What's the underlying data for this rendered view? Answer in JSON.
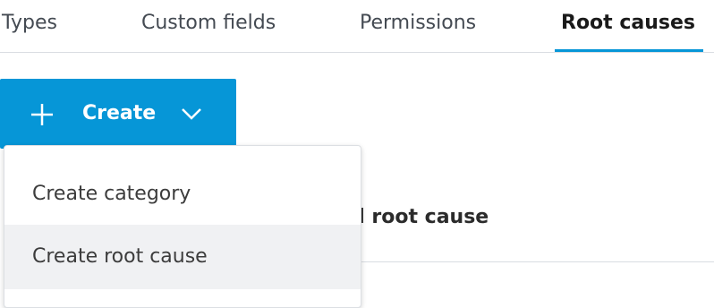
{
  "tabs": [
    {
      "label": "Types",
      "active": false
    },
    {
      "label": "Custom fields",
      "active": false
    },
    {
      "label": "Permissions",
      "active": false
    },
    {
      "label": "Root causes",
      "active": true
    }
  ],
  "create_button": {
    "label": "Create",
    "icon": "plus-icon",
    "dropdown_icon": "chevron-down-icon"
  },
  "dropdown": {
    "items": [
      {
        "label": "Create category"
      },
      {
        "label": "Create root cause",
        "hovered": true
      }
    ]
  },
  "background": {
    "partial_heading": "d root cause"
  },
  "colors": {
    "accent": "#0696d7",
    "hover": "#f0f1f3"
  }
}
